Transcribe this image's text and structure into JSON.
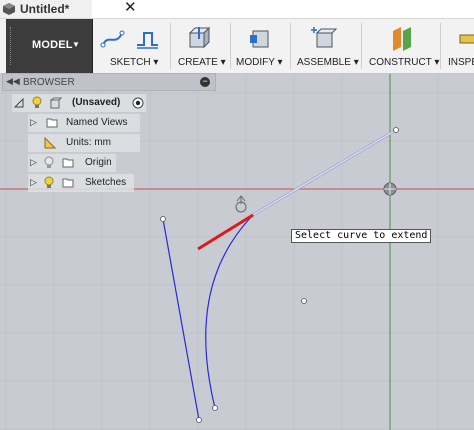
{
  "document": {
    "title": "Untitled*"
  },
  "toolbar": {
    "workspace": "MODEL",
    "groups": [
      "SKETCH ▾",
      "CREATE ▾",
      "MODIFY ▾",
      "ASSEMBLE ▾",
      "CONSTRUCT ▾",
      "INSPE"
    ]
  },
  "browser": {
    "title": "BROWSER",
    "items": [
      {
        "label": "(Unsaved)"
      },
      {
        "label": "Named Views"
      },
      {
        "label": "Units: mm"
      },
      {
        "label": "Origin"
      },
      {
        "label": "Sketches"
      }
    ]
  },
  "canvas": {
    "tooltip": "Select curve to extend"
  },
  "colors": {
    "canvas_bg": "#c8ccd2",
    "grid_line": "#b8bcc3",
    "axis_red": "#c84c4c",
    "axis_green": "#3c9a3c",
    "curve_blue": "#2a2ad0",
    "highlight_red": "#e01818",
    "workspace_dark": "#3c3c3c"
  }
}
